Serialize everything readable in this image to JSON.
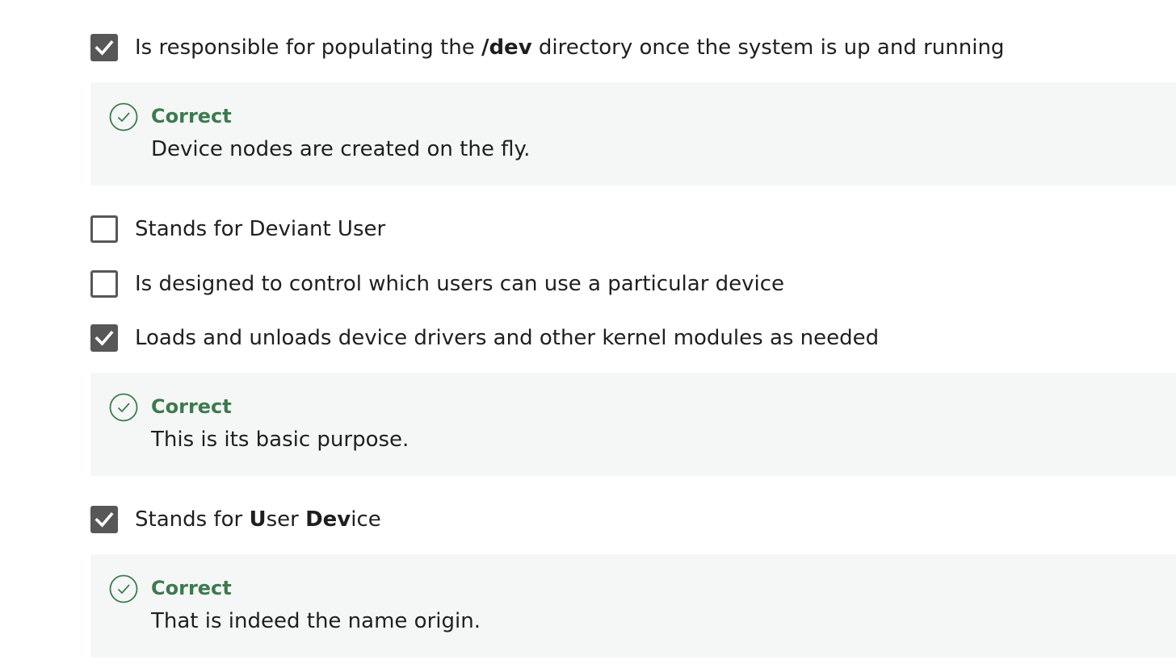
{
  "options": [
    {
      "checked": true,
      "label": {
        "prefix": "Is responsible for populating the ",
        "bold": "/dev",
        "suffix": " directory once the system is up and running"
      },
      "feedback": {
        "title": "Correct",
        "text": "Device nodes are created on the fly."
      }
    },
    {
      "checked": false,
      "label": "Stands for Deviant User"
    },
    {
      "checked": false,
      "label": "Is designed to control which users can use a particular device"
    },
    {
      "checked": true,
      "label": "Loads and unloads device drivers and other kernel modules as needed",
      "feedback": {
        "title": "Correct",
        "text": "This is its basic purpose."
      }
    },
    {
      "checked": true,
      "label": {
        "p1": "Stands for ",
        "b1": "U",
        "p2": "ser ",
        "b2": "Dev",
        "p3": "ice"
      },
      "feedback": {
        "title": "Correct",
        "text": "That is indeed the name origin."
      }
    }
  ],
  "icons": {
    "checkmark": "checkmark-icon",
    "correct": "check-circle-icon"
  },
  "colors": {
    "checkbox": "#575757",
    "correct": "#3d7a4e",
    "feedback_bg": "#f5f7f6",
    "text": "#1f1f1f"
  }
}
